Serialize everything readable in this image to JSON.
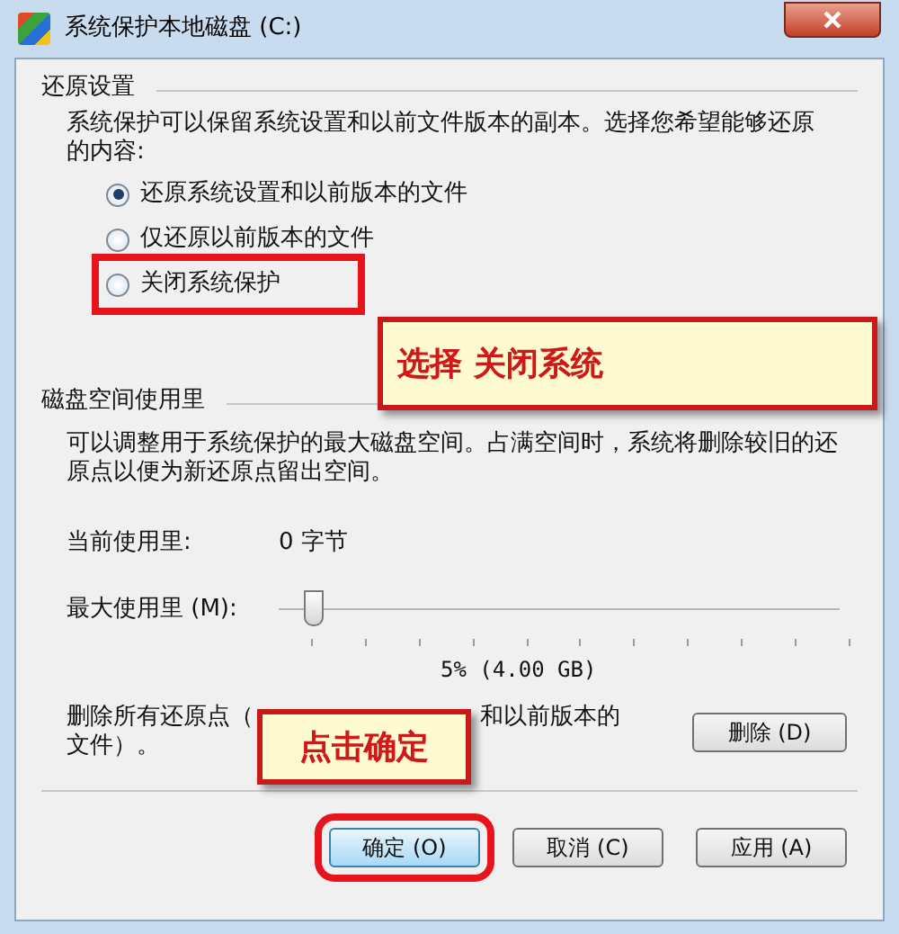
{
  "window": {
    "title": "系统保护本地磁盘 (C:)"
  },
  "restore_settings": {
    "heading": "还原设置",
    "description": "系统保护可以保留系统设置和以前文件版本的副本。选择您希望能够还原的内容:",
    "options": [
      {
        "label": "还原系统设置和以前版本的文件",
        "selected": true,
        "highlight": false
      },
      {
        "label": "仅还原以前版本的文件",
        "selected": false,
        "highlight": false
      },
      {
        "label": "关闭系统保护",
        "selected": false,
        "highlight": true
      }
    ]
  },
  "disk_usage": {
    "heading": "磁盘空间使用里",
    "description": "可以调整用于系统保护的最大磁盘空间。占满空间时，系统将删除较旧的还原点以便为新还原点留出空间。",
    "current_label": "当前使用里:",
    "current_value": "0 字节",
    "max_label": "最大使用里 (M):",
    "max_slider": {
      "level": 0.06
    },
    "max_reading": "5% (4.00 GB)",
    "delete_text_parts": [
      "删除所有还原点（",
      "和以前版本的",
      "文件）。"
    ],
    "delete_button": "删除 (D)"
  },
  "buttons": [
    {
      "label": "确定 (O)",
      "highlight": true
    },
    {
      "label": "取消 (C)",
      "highlight": false
    },
    {
      "label": "应用 (A)",
      "highlight": false
    }
  ],
  "callouts": [
    {
      "text": "选择 关闭系统"
    },
    {
      "text": "点击确定"
    }
  ]
}
